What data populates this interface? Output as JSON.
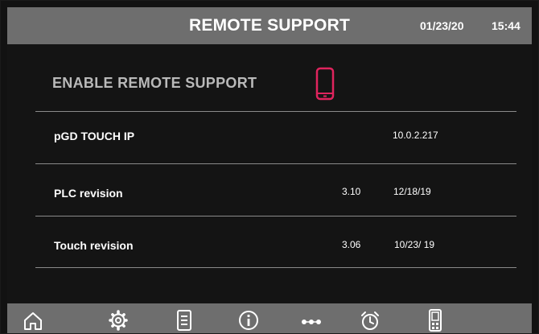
{
  "header": {
    "title": "REMOTE SUPPORT",
    "date": "01/23/20",
    "time": "15:44"
  },
  "remote": {
    "enable_label": "ENABLE REMOTE SUPPORT",
    "phone_icon": "smartphone-icon",
    "accent_color": "#e0245e"
  },
  "rows": [
    {
      "label": "pGD TOUCH IP",
      "value": "10.0.2.217"
    },
    {
      "label": "PLC revision",
      "version": "3.10",
      "date": "12/18/19"
    },
    {
      "label": "Touch revision",
      "version": "3.06",
      "date": "10/23/ 19"
    }
  ],
  "nav": {
    "items": [
      "home-icon",
      "gear-icon",
      "list-icon",
      "info-icon",
      "more-icon",
      "alarm-clock-icon",
      "device-icon"
    ]
  },
  "colors": {
    "bar": "#6e6e6e",
    "background": "#141414",
    "text": "#ffffff"
  }
}
